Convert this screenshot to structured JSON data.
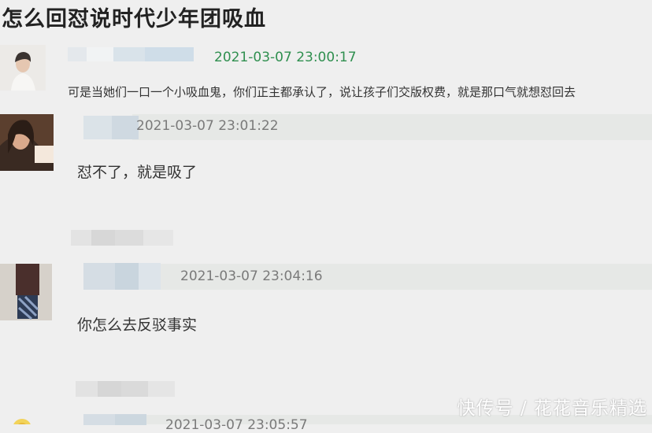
{
  "page": {
    "title": "怎么回怼说时代少年团吸血"
  },
  "comments": [
    {
      "timestamp": "2021-03-07 23:00:17",
      "text": "可是当她们一口一个小吸血鬼，你们正主都承认了，说让孩子们交版权费，就是那口气就想怼回去"
    },
    {
      "timestamp": "2021-03-07 23:01:22",
      "text": "怼不了，就是吸了"
    },
    {
      "timestamp": "2021-03-07 23:04:16",
      "text": "你怎么去反驳事实"
    },
    {
      "timestamp": "2021-03-07 23:05:57"
    }
  ],
  "watermark": "快传号 / 花花音乐精选",
  "colors": {
    "first_timestamp": "#2f8f4f",
    "background": "#efefef"
  }
}
